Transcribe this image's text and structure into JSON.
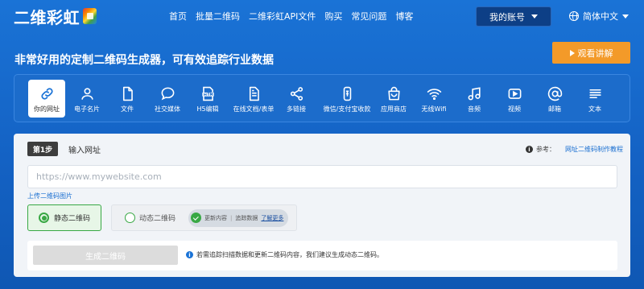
{
  "header": {
    "logo_text": "二维彩虹",
    "nav": [
      "首页",
      "批量二维码",
      "二维彩虹API文件",
      "购买",
      "常见问题",
      "博客"
    ],
    "account_label": "我的账号",
    "language_label": "简体中文"
  },
  "hero": {
    "headline": "非常好用的定制二维码生成器，可有效追踪行业数据",
    "video_button": "观看讲解"
  },
  "types": [
    {
      "label": "你的网址",
      "icon": "link-icon",
      "active": true
    },
    {
      "label": "电子名片",
      "icon": "person-icon",
      "active": false
    },
    {
      "label": "文件",
      "icon": "file-icon",
      "active": false
    },
    {
      "label": "社交媒体",
      "icon": "chat-bubble-icon",
      "active": false
    },
    {
      "label": "H5编辑",
      "icon": "html-icon",
      "active": false
    },
    {
      "label": "在线文档/表单",
      "icon": "document-icon",
      "active": false
    },
    {
      "label": "多链接",
      "icon": "share-icon",
      "active": false
    },
    {
      "label": "微信/支付宝收款",
      "icon": "wallet-icon",
      "active": false
    },
    {
      "label": "应用商店",
      "icon": "store-icon",
      "active": false
    },
    {
      "label": "无线Wifi",
      "icon": "wifi-icon",
      "active": false
    },
    {
      "label": "音频",
      "icon": "music-icon",
      "active": false
    },
    {
      "label": "视频",
      "icon": "video-icon",
      "active": false
    },
    {
      "label": "邮箱",
      "icon": "at-icon",
      "active": false
    },
    {
      "label": "文本",
      "icon": "text-icon",
      "active": false
    }
  ],
  "step": {
    "badge": "第1步",
    "title": "输入网址",
    "ref_label": "参考：",
    "ref_link": "网址二维码制作教程",
    "url_placeholder": "https://www.mywebsite.com",
    "url_value": "",
    "upload_link": "上传二维码图片",
    "static_label": "静态二维码",
    "static_selected": true,
    "dynamic_label": "动态二维码",
    "dynamic_pill_text": "更新内容",
    "dynamic_pill_sep": "|",
    "dynamic_pill_text2": "追踪数据",
    "dynamic_pill_more": "了解更多",
    "generate_button": "生成二维码",
    "generate_note": "若需追踪扫描数据和更新二维码内容，我们建议生成动态二维码。"
  },
  "colors": {
    "background": "#1a73d6",
    "accent_orange": "#f39a29",
    "accent_green": "#38a844",
    "link_blue": "#1a6fd1"
  }
}
